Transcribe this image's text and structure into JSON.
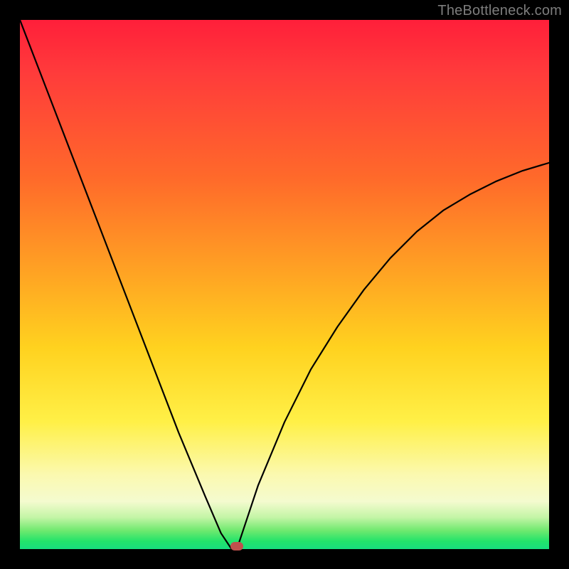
{
  "watermark": {
    "text": "TheBottleneck.com"
  },
  "colors": {
    "background": "#000000",
    "watermark": "#7d7d7d",
    "curve": "#000000",
    "marker": "#c0504d"
  },
  "chart_data": {
    "type": "line",
    "title": "",
    "xlabel": "",
    "ylabel": "",
    "xlim": [
      0,
      100
    ],
    "ylim": [
      0,
      100
    ],
    "grid": false,
    "legend": false,
    "series": [
      {
        "name": "bottleneck-curve",
        "x": [
          0,
          5,
          10,
          15,
          20,
          25,
          30,
          35,
          38,
          40,
          41,
          42,
          45,
          50,
          55,
          60,
          65,
          70,
          75,
          80,
          85,
          90,
          95,
          100
        ],
        "y": [
          100,
          87,
          74,
          61,
          48,
          35,
          22,
          10,
          3,
          0,
          0,
          3,
          12,
          24,
          34,
          42,
          49,
          55,
          60,
          64,
          67,
          69.5,
          71.5,
          73
        ]
      }
    ],
    "marker": {
      "x": 41,
      "y": 0,
      "label": "optimal-point"
    },
    "gradient_stops": [
      {
        "pos": 0.0,
        "color": "#ff1f3a"
      },
      {
        "pos": 0.3,
        "color": "#ff6a2a"
      },
      {
        "pos": 0.62,
        "color": "#ffd21f"
      },
      {
        "pos": 0.86,
        "color": "#fbf9b0"
      },
      {
        "pos": 0.97,
        "color": "#6fe96f"
      },
      {
        "pos": 1.0,
        "color": "#18dd7e"
      }
    ]
  }
}
